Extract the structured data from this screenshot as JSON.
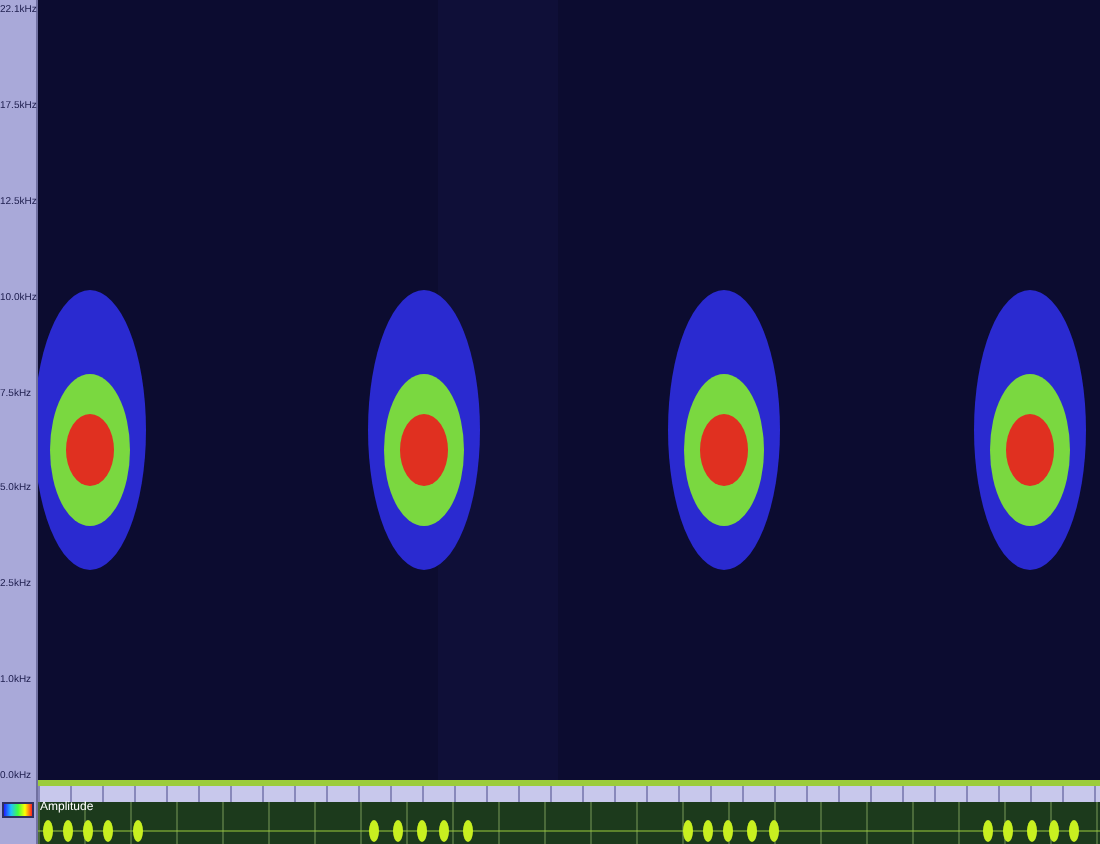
{
  "frequency_axis": {
    "labels": [
      "22.1kHz",
      "17.5kHz",
      "12.5kHz",
      "10.0kHz",
      "7.5kHz",
      "5.0kHz",
      "2.5kHz",
      "1.0kHz",
      "0.0kHz"
    ]
  },
  "waveform": {
    "label": "Amplitude"
  }
}
